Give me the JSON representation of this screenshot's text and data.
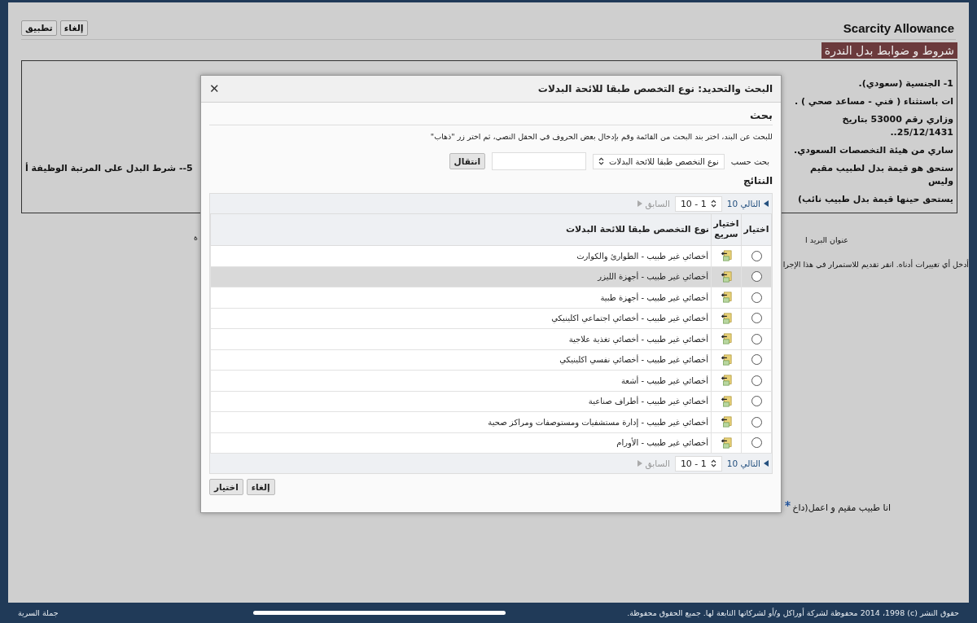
{
  "page": {
    "title": "Scarcity Allowance",
    "buttons": [
      {
        "label": "إلغاء"
      },
      {
        "label": "تطبيق"
      }
    ],
    "section_heading": "شروط و ضوابط بدل الندرة",
    "terms_lines": [
      {
        "right": "1- الجنسية (سعودي)."
      },
      {
        "right": "ات باستثناء ( فني - مساعد صحي ) ."
      },
      {
        "right": "وزاري رقم 53000 بتاريخ 25/12/1431.."
      },
      {
        "right": "ساري من هيئة التخصصات السعودي."
      },
      {
        "left": "5-- شرط البدل على المرتبة الوظيفة أ",
        "right": "ستحق هو قيمة بدل لطبيب مقيم وليس"
      },
      {
        "right": "يستحق حينها قيمة بدل طبيب نائب)"
      }
    ],
    "form_lines": [
      {
        "right": "عنوان البريد ا",
        "left": "ة"
      },
      {
        "right": "أدخل أي تغييرات أدناه. انقر تقديم للاستمرار في هذا الإجرا"
      },
      {
        "right": "انا طبيب مقيم و اعمل(داخ",
        "required": true
      }
    ]
  },
  "dialog": {
    "title": "البحث والتحديد: نوع التخصص طبقا للائحة البدلات",
    "close_label": "✕",
    "search_heading": "بحث",
    "instructions": "للبحث عن البند، اختر بند البحث من القائمة وقم بإدخال بعض الحروف في الحقل النصي، ثم اختر زر \"ذهاب\"",
    "search_by_label": "بحث حسب",
    "search_by_value": "نوع التخصص طبقا للائحة البدلات",
    "go_button": "انتقال",
    "results_heading": "النتائج",
    "navigators": [
      {
        "previous": {
          "label": "السابق",
          "disabled": true
        },
        "range": "1 - 10",
        "next": {
          "label": "التالي 10",
          "disabled": false
        }
      },
      {
        "previous": {
          "label": "السابق",
          "disabled": true
        },
        "range": "1 - 10",
        "next": {
          "label": "التالي 10",
          "disabled": false
        }
      }
    ],
    "columns": [
      "اختيار",
      "اختيار سريع",
      "نوع التخصص طبقا للائحة البدلات"
    ],
    "rows": [
      {
        "name": "أخصائي غير طبيب - الطوارئ والكوارث",
        "selected": false,
        "checked": false
      },
      {
        "name": "أخصائي غير طبيب - أجهزة الليزر",
        "selected": true,
        "checked": false
      },
      {
        "name": "أخصائي غير طبيب - أجهزة طبية",
        "selected": false,
        "checked": false
      },
      {
        "name": "أخصائي غير طبيب - أخصائي اجتماعي اكلينيكي",
        "selected": false,
        "checked": false
      },
      {
        "name": "أخصائي غير طبيب - أخصائي تغذية علاجية",
        "selected": false,
        "checked": false
      },
      {
        "name": "أخصائي غير طبيب - أخصائي نفسي اكلينيكي",
        "selected": false,
        "checked": false
      },
      {
        "name": "أخصائي غير طبيب - أشعة",
        "selected": false,
        "checked": false
      },
      {
        "name": "أخصائي غير طبيب - أطراف صناعية",
        "selected": false,
        "checked": false
      },
      {
        "name": "أخصائي غير طبيب - إدارة مستشفيات ومستوصفات ومراكز صحية",
        "selected": false,
        "checked": false
      },
      {
        "name": "أخصائي غير طبيب - الأورام",
        "selected": false,
        "checked": false
      }
    ],
    "buttons": [
      {
        "label": "إلغاء"
      },
      {
        "label": "اختيار"
      }
    ]
  },
  "footer": {
    "privacy_link": "جملة السرية",
    "copyright": "حقوق النشر (c) 2014 ،1998 محفوظة لشركة أوراكل و/أو لشركاتها التابعة لها. جميع الحقوق محفوظة."
  }
}
